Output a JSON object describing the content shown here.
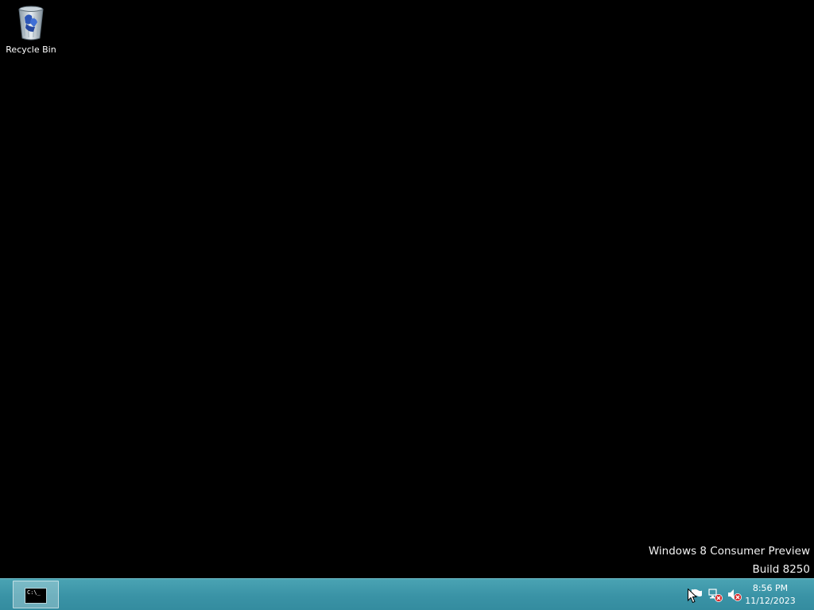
{
  "desktop": {
    "icons": [
      {
        "label": "Recycle Bin",
        "icon": "recycle-bin-icon"
      }
    ],
    "watermark": {
      "line1": "Windows 8 Consumer Preview",
      "line2": "Build 8250"
    }
  },
  "taskbar": {
    "running_apps": [
      {
        "icon": "command-prompt-icon",
        "glyph_text": "C:\\_"
      }
    ],
    "tray": {
      "icons": [
        "action-center-flag-icon",
        "network-disconnected-icon",
        "volume-muted-icon"
      ],
      "time": "8:56 PM",
      "date": "11/12/2023"
    },
    "color": "#3a93a6"
  }
}
